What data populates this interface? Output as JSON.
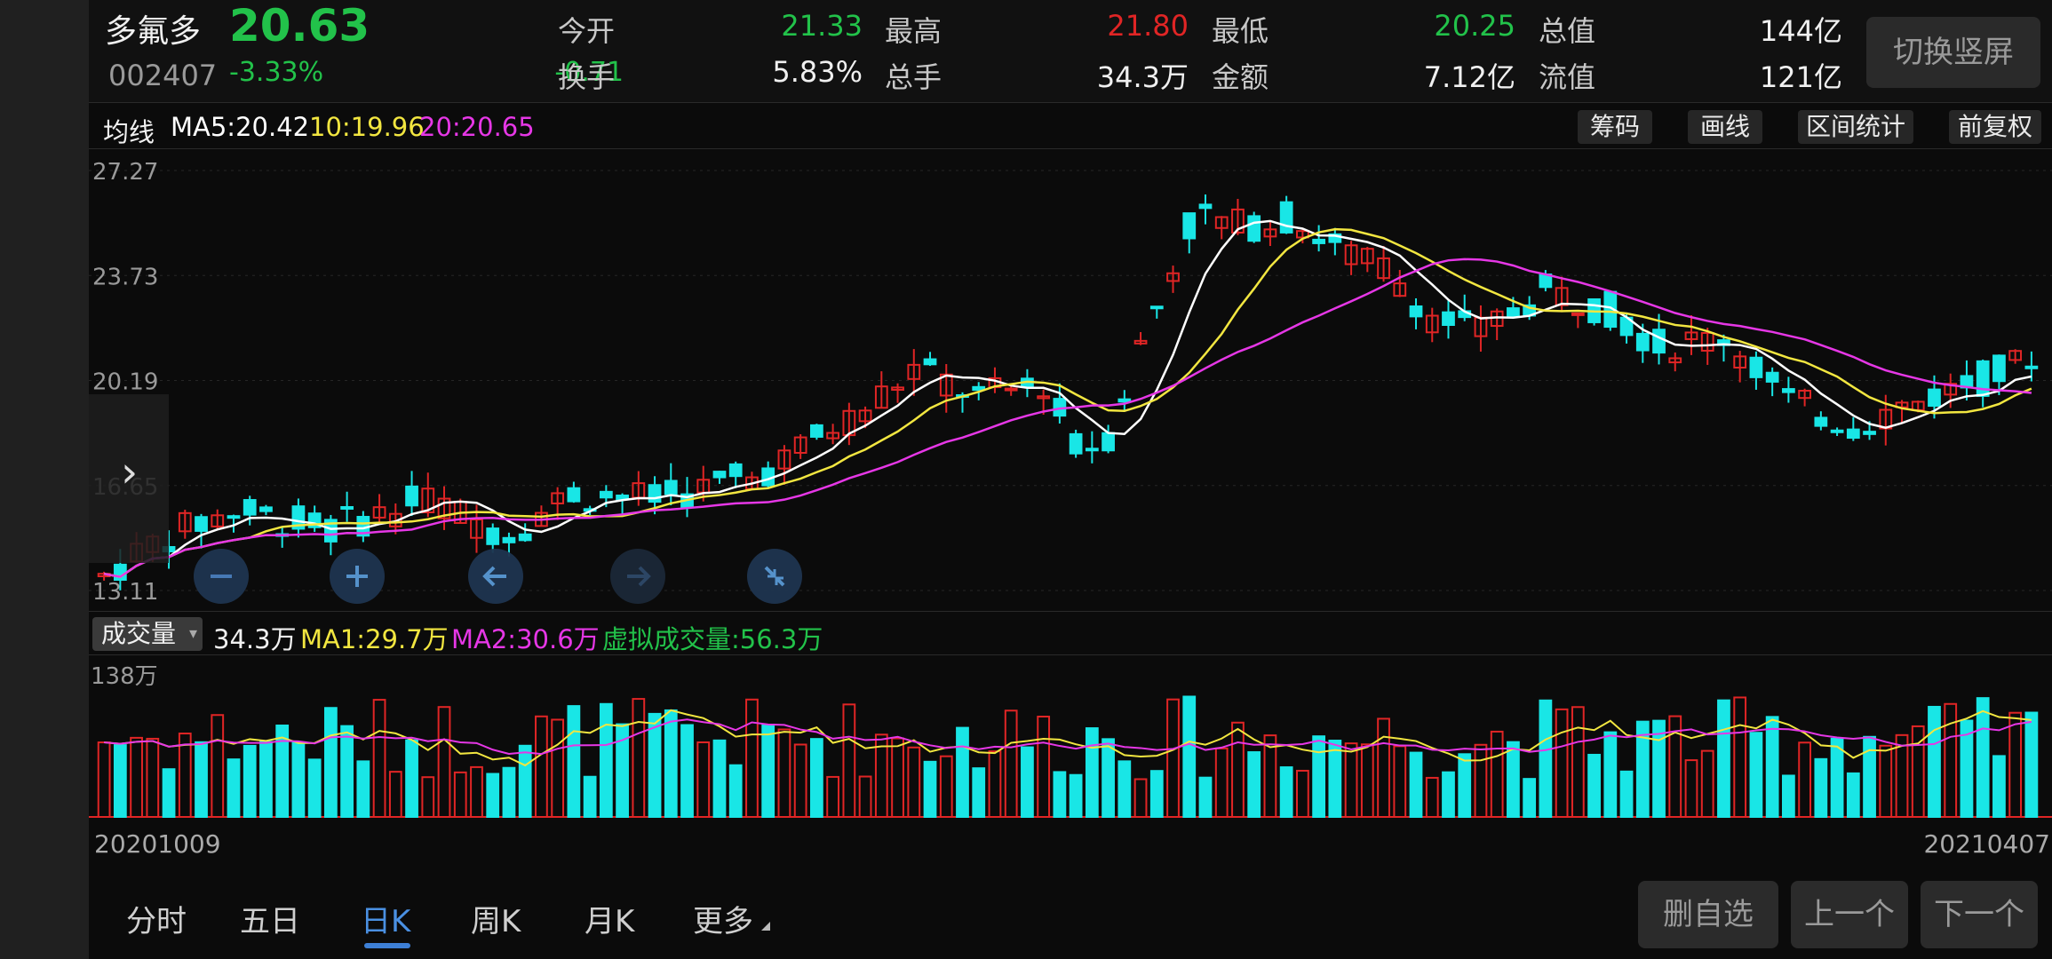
{
  "stock": {
    "name": "多氟多",
    "price": "20.63",
    "code": "002407",
    "change_pct": "-3.33%",
    "change": "-0.71"
  },
  "stats": [
    {
      "label": "今开",
      "value": "21.33",
      "color": "green"
    },
    {
      "label": "最高",
      "value": "21.80",
      "color": "red"
    },
    {
      "label": "最低",
      "value": "20.25",
      "color": "green"
    },
    {
      "label": "总值",
      "value": "144亿",
      "color": "white"
    },
    {
      "label": "换手",
      "value": "5.83%",
      "color": "white"
    },
    {
      "label": "总手",
      "value": "34.3万",
      "color": "white"
    },
    {
      "label": "金额",
      "value": "7.12亿",
      "color": "white"
    },
    {
      "label": "流值",
      "value": "121亿",
      "color": "white"
    }
  ],
  "switch_button": "切换竖屏",
  "ma_bar": {
    "label": "均线",
    "ma5": "MA5:20.42",
    "ma10": "10:19.96",
    "ma20": "20:20.65"
  },
  "tool_buttons": [
    "筹码",
    "画线",
    "区间统计",
    "前复权"
  ],
  "kline": {
    "y_ticks": [
      "27.27",
      "23.73",
      "20.19",
      "16.65",
      "13.11"
    ]
  },
  "volume": {
    "select_label": "成交量",
    "current": "34.3万",
    "ma1": "MA1:29.7万",
    "ma2": "MA2:30.6万",
    "virtual": "虚拟成交量:56.3万",
    "max_tick": "138万"
  },
  "dates": {
    "start": "20201009",
    "end": "20210407"
  },
  "tabs": [
    "分时",
    "五日",
    "日K",
    "周K",
    "月K",
    "更多"
  ],
  "active_tab": "日K",
  "bottom_buttons": [
    "删自选",
    "上一个",
    "下一个"
  ],
  "colors": {
    "up": "#e02525",
    "down": "#19e6e6",
    "ma5": "#ffffff",
    "ma10": "#f2e640",
    "ma20": "#e637e6",
    "accent": "#3d7fd6"
  },
  "chart_data": {
    "type": "candlestick",
    "y_range": [
      13.11,
      27.27
    ],
    "x_range": [
      "20201009",
      "20210407"
    ],
    "ohlc_series": [],
    "volume_max": "138万"
  }
}
